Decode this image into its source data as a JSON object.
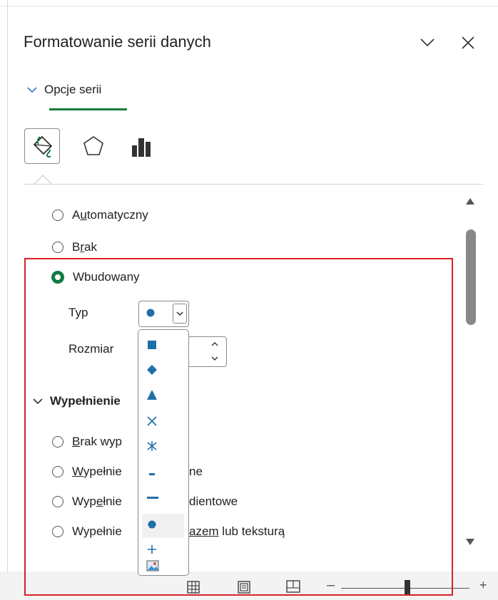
{
  "panel": {
    "title": "Formatowanie serii danych",
    "tab_label": "Opcje serii"
  },
  "icons": {
    "fill_line_tab": "paint-bucket-icon",
    "effects_tab": "pentagon-icon",
    "series_options_tab": "bar-chart-icon"
  },
  "marker": {
    "options": [
      {
        "label": "Automatyczny",
        "accel": "u",
        "selected": false
      },
      {
        "label": "Brak",
        "accel": "r",
        "selected": false
      },
      {
        "label": "Wbudowany",
        "accel": "",
        "selected": true
      }
    ],
    "type_label": "Typ",
    "size_label": "Rozmiar"
  },
  "fill_section": {
    "header": "Wypełnienie",
    "options": [
      {
        "label": "Brak wyp",
        "accel": "B"
      },
      {
        "label": "Wypełnie",
        "accel": "W",
        "suffix": "ne"
      },
      {
        "label": "Wypełnie",
        "accel": "e",
        "suffix": "dientowe"
      },
      {
        "label": "Wypełnie",
        "accel": "",
        "suffix_prefix": "azem",
        "suffix": " lub teksturą"
      }
    ]
  },
  "dropdown_items": [
    {
      "name": "square"
    },
    {
      "name": "diamond"
    },
    {
      "name": "triangle"
    },
    {
      "name": "x"
    },
    {
      "name": "star"
    },
    {
      "name": "short-dash"
    },
    {
      "name": "long-dash"
    },
    {
      "name": "circle"
    },
    {
      "name": "plus"
    },
    {
      "name": "picture"
    }
  ],
  "colors": {
    "accent_green": "#107c41",
    "highlight_red": "#d92027",
    "marker_blue": "#1f6fa8"
  },
  "statusbar": {
    "zoom_minus": "–",
    "zoom_plus": "+"
  }
}
